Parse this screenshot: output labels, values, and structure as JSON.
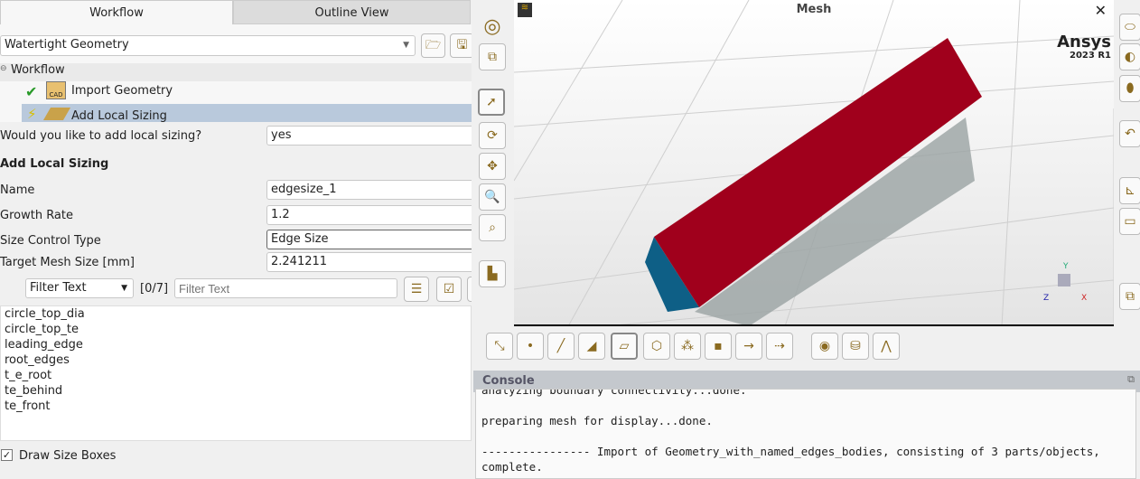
{
  "tabs": {
    "workflow": "Workflow",
    "outline": "Outline View"
  },
  "workflow_select": "Watertight Geometry",
  "tree": {
    "root": "Workflow",
    "items": [
      "Import Geometry",
      "Add Local Sizing"
    ]
  },
  "form": {
    "question": "Would you like to add local sizing?",
    "question_value": "yes",
    "section": "Add Local Sizing",
    "name_label": "Name",
    "name_value": "edgesize_1",
    "growth_label": "Growth Rate",
    "growth_value": "1.2",
    "type_label": "Size Control Type",
    "type_value": "Edge Size",
    "target_label": "Target Mesh Size [mm]",
    "target_value": "2.241211",
    "filter_select": "Filter Text",
    "count": "[0/7]",
    "filter_placeholder": "Filter Text",
    "list": [
      "circle_top_dia",
      "circle_top_te",
      "leading_edge",
      "root_edges",
      "t_e_root",
      "te_behind",
      "te_front"
    ],
    "draw_boxes": "Draw Size Boxes"
  },
  "viewport": {
    "title": "Mesh",
    "brand": "Ansys",
    "version": "2023 R1",
    "axis_labels": [
      "Y",
      "Z",
      "X"
    ]
  },
  "console": {
    "title": "Console",
    "lines": [
      "analyzing boundary connectivity...done.",
      "",
      "preparing mesh for display...done.",
      "",
      "---------------- Import of Geometry_with_named_edges_bodies, consisting of 3 parts/objects,",
      "complete."
    ]
  },
  "colors": {
    "body": "#a0001c",
    "end": "#0e5f86",
    "selection": "#b9c9dc"
  }
}
